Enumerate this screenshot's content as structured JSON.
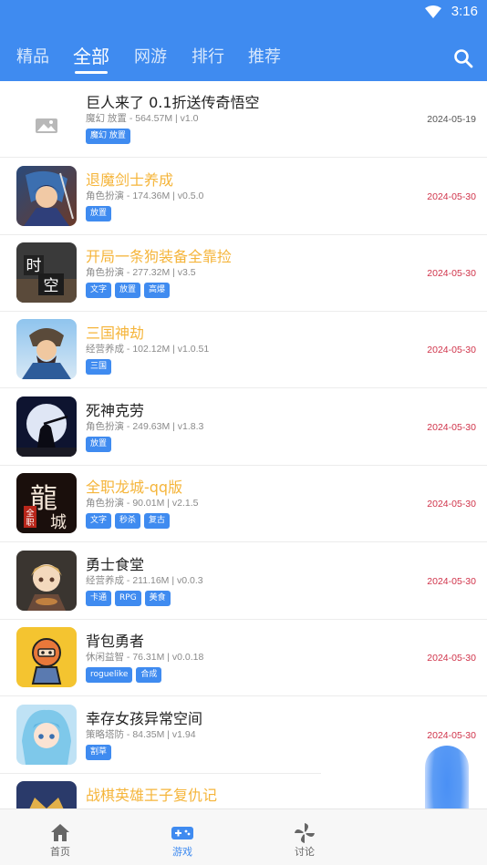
{
  "status_bar": {
    "time": "3:16"
  },
  "tabs": [
    {
      "label": "精品",
      "active": false
    },
    {
      "label": "全部",
      "active": true
    },
    {
      "label": "网游",
      "active": false
    },
    {
      "label": "排行",
      "active": false
    },
    {
      "label": "推荐",
      "active": false
    }
  ],
  "games": [
    {
      "title": "巨人来了 0.1折送传奇悟空",
      "highlight": false,
      "meta": "魔幻 放置 - 564.57M | v1.0",
      "tags": [
        "魔幻 放置"
      ],
      "date": "2024-05-19",
      "date_color": "#555555",
      "icon": "placeholder-image-icon"
    },
    {
      "title": "退魔剑士养成",
      "highlight": true,
      "meta": "角色扮演 - 174.36M | v0.5.0",
      "tags": [
        "放置"
      ],
      "date": "2024-05-30",
      "date_color": "#d0334a",
      "icon": "swordsman-game-icon"
    },
    {
      "title": "开局一条狗装备全靠捡",
      "highlight": true,
      "meta": "角色扮演 - 277.32M | v3.5",
      "tags": [
        "文字",
        "放置",
        "高爆"
      ],
      "date": "2024-05-30",
      "date_color": "#d0334a",
      "icon": "shikong-game-icon"
    },
    {
      "title": "三国神劫",
      "highlight": true,
      "meta": "经营养成 - 102.12M | v1.0.51",
      "tags": [
        "三国"
      ],
      "date": "2024-05-30",
      "date_color": "#d0334a",
      "icon": "three-kingdoms-game-icon"
    },
    {
      "title": "死神克劳",
      "highlight": false,
      "meta": "角色扮演 - 249.63M | v1.8.3",
      "tags": [
        "放置"
      ],
      "date": "2024-05-30",
      "date_color": "#d0334a",
      "icon": "moon-reaper-game-icon"
    },
    {
      "title": "全职龙城-qq版",
      "highlight": true,
      "meta": "角色扮演 - 90.01M | v2.1.5",
      "tags": [
        "文字",
        "秒杀",
        "复古"
      ],
      "date": "2024-05-30",
      "date_color": "#d0334a",
      "icon": "dragon-city-game-icon"
    },
    {
      "title": "勇士食堂",
      "highlight": false,
      "meta": "经营养成 - 211.16M | v0.0.3",
      "tags": [
        "卡通",
        "RPG",
        "美食"
      ],
      "date": "2024-05-30",
      "date_color": "#d0334a",
      "icon": "warrior-canteen-game-icon"
    },
    {
      "title": "背包勇者",
      "highlight": false,
      "meta": "休闲益智 - 76.31M | v0.0.18",
      "tags": [
        "roguelike",
        "合成"
      ],
      "date": "2024-05-30",
      "date_color": "#d0334a",
      "icon": "backpack-hero-game-icon"
    },
    {
      "title": "幸存女孩异常空间",
      "highlight": false,
      "meta": "策略塔防 - 84.35M | v1.94",
      "tags": [
        "割草"
      ],
      "date": "2024-05-30",
      "date_color": "#d0334a",
      "icon": "survivor-girl-game-icon"
    },
    {
      "title": "战棋英雄王子复仇记",
      "highlight": true,
      "meta": "",
      "tags": [],
      "date": "",
      "date_color": "#d0334a",
      "icon": "chess-hero-game-icon"
    }
  ],
  "bottom_nav": [
    {
      "label": "首页",
      "icon": "home-icon",
      "active": false
    },
    {
      "label": "游戏",
      "icon": "gamepad-icon",
      "active": true
    },
    {
      "label": "讨论",
      "icon": "pinwheel-icon",
      "active": false
    }
  ],
  "colors": {
    "primary": "#3f8bf0",
    "highlight_title": "#f5b53b",
    "date_red": "#d0334a"
  }
}
